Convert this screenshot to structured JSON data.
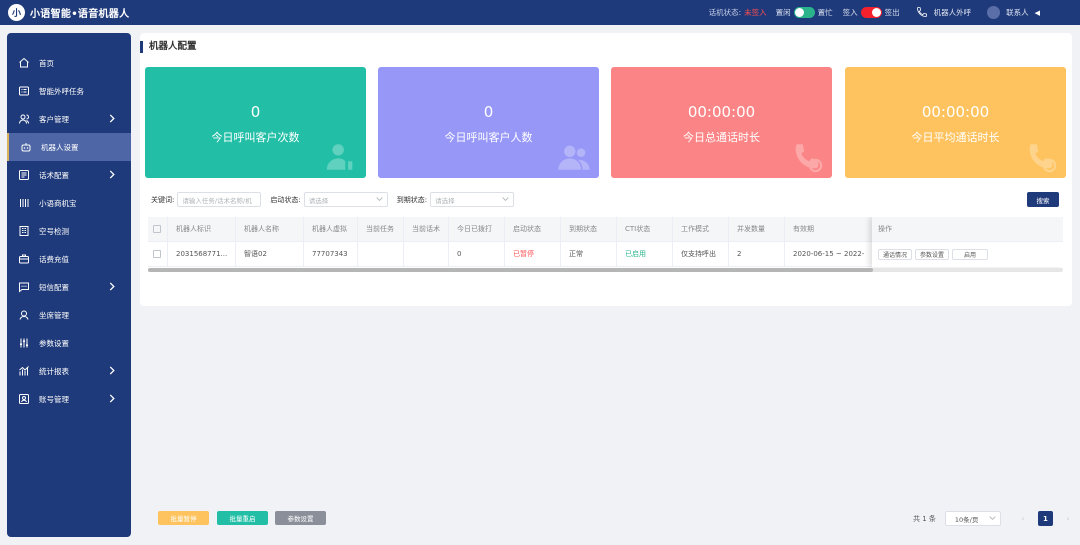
{
  "header": {
    "logo_mark": "小",
    "app_title": "小语智能•语音机器人",
    "phone_status_label": "话机状态:",
    "phone_status_value": "未签入",
    "idle_label": "置闲",
    "busy_label": "置忙",
    "signin_label": "签入",
    "signout_label": "签出",
    "robot_call_label": "机器人外呼",
    "contact_label": "联系人"
  },
  "sidebar": {
    "items": [
      {
        "label": "首页"
      },
      {
        "label": "智能外呼任务"
      },
      {
        "label": "客户管理"
      },
      {
        "label": "机器人设置"
      },
      {
        "label": "话术配置"
      },
      {
        "label": "小语商机宝"
      },
      {
        "label": "空号检测"
      },
      {
        "label": "话费充值"
      },
      {
        "label": "短信配置"
      },
      {
        "label": "坐席管理"
      },
      {
        "label": "参数设置"
      },
      {
        "label": "统计报表"
      },
      {
        "label": "账号管理"
      }
    ]
  },
  "page": {
    "title": "机器人配置"
  },
  "stats": [
    {
      "value": "0",
      "label": "今日呼叫客户次数",
      "color": "#22bfa6"
    },
    {
      "value": "0",
      "label": "今日呼叫客户人数",
      "color": "#9797f8"
    },
    {
      "value": "00:00:00",
      "label": "今日总通话时长",
      "color": "#fb8586"
    },
    {
      "value": "00:00:00",
      "label": "今日平均通话时长",
      "color": "#fec35e"
    }
  ],
  "filters": {
    "keyword_label": "关键词:",
    "keyword_placeholder": "请输入任务/话术名称/机",
    "start_status_label": "启动状态:",
    "start_status_placeholder": "请选择",
    "expire_status_label": "到期状态:",
    "expire_status_placeholder": "请选择",
    "search_label": "搜索"
  },
  "table": {
    "columns": [
      "机器人标识",
      "机器人名称",
      "机器人虚拟",
      "当前任务",
      "当前话术",
      "今日已拨打",
      "启动状态",
      "到期状态",
      "CTI状态",
      "工作模式",
      "并发数量",
      "有效期"
    ],
    "ops_header": "操作",
    "rows": [
      {
        "cells": [
          "2031568771...",
          "智语02",
          "77707343",
          "",
          "",
          "0",
          "已暂停",
          "正常",
          "已启用",
          "仅支持呼出",
          "2",
          "2020-06-15 ~ 2022-"
        ],
        "ops": [
          "通话情况",
          "参数设置",
          "启用"
        ]
      }
    ]
  },
  "bottom": {
    "batch_pause": "批量暂停",
    "batch_restart": "批量重启",
    "param_settings": "参数设置",
    "total": "共 1 条",
    "page_size": "10条/页",
    "prev": "‹",
    "current_page": "1",
    "next": "›"
  },
  "colors": {
    "primary": "#1f3a7a",
    "status_red": "#ff4d4f",
    "status_green": "#2bb48b",
    "btn_yellow": "#fec35e",
    "btn_teal": "#22bfa6",
    "btn_gray": "#8a8f99"
  }
}
